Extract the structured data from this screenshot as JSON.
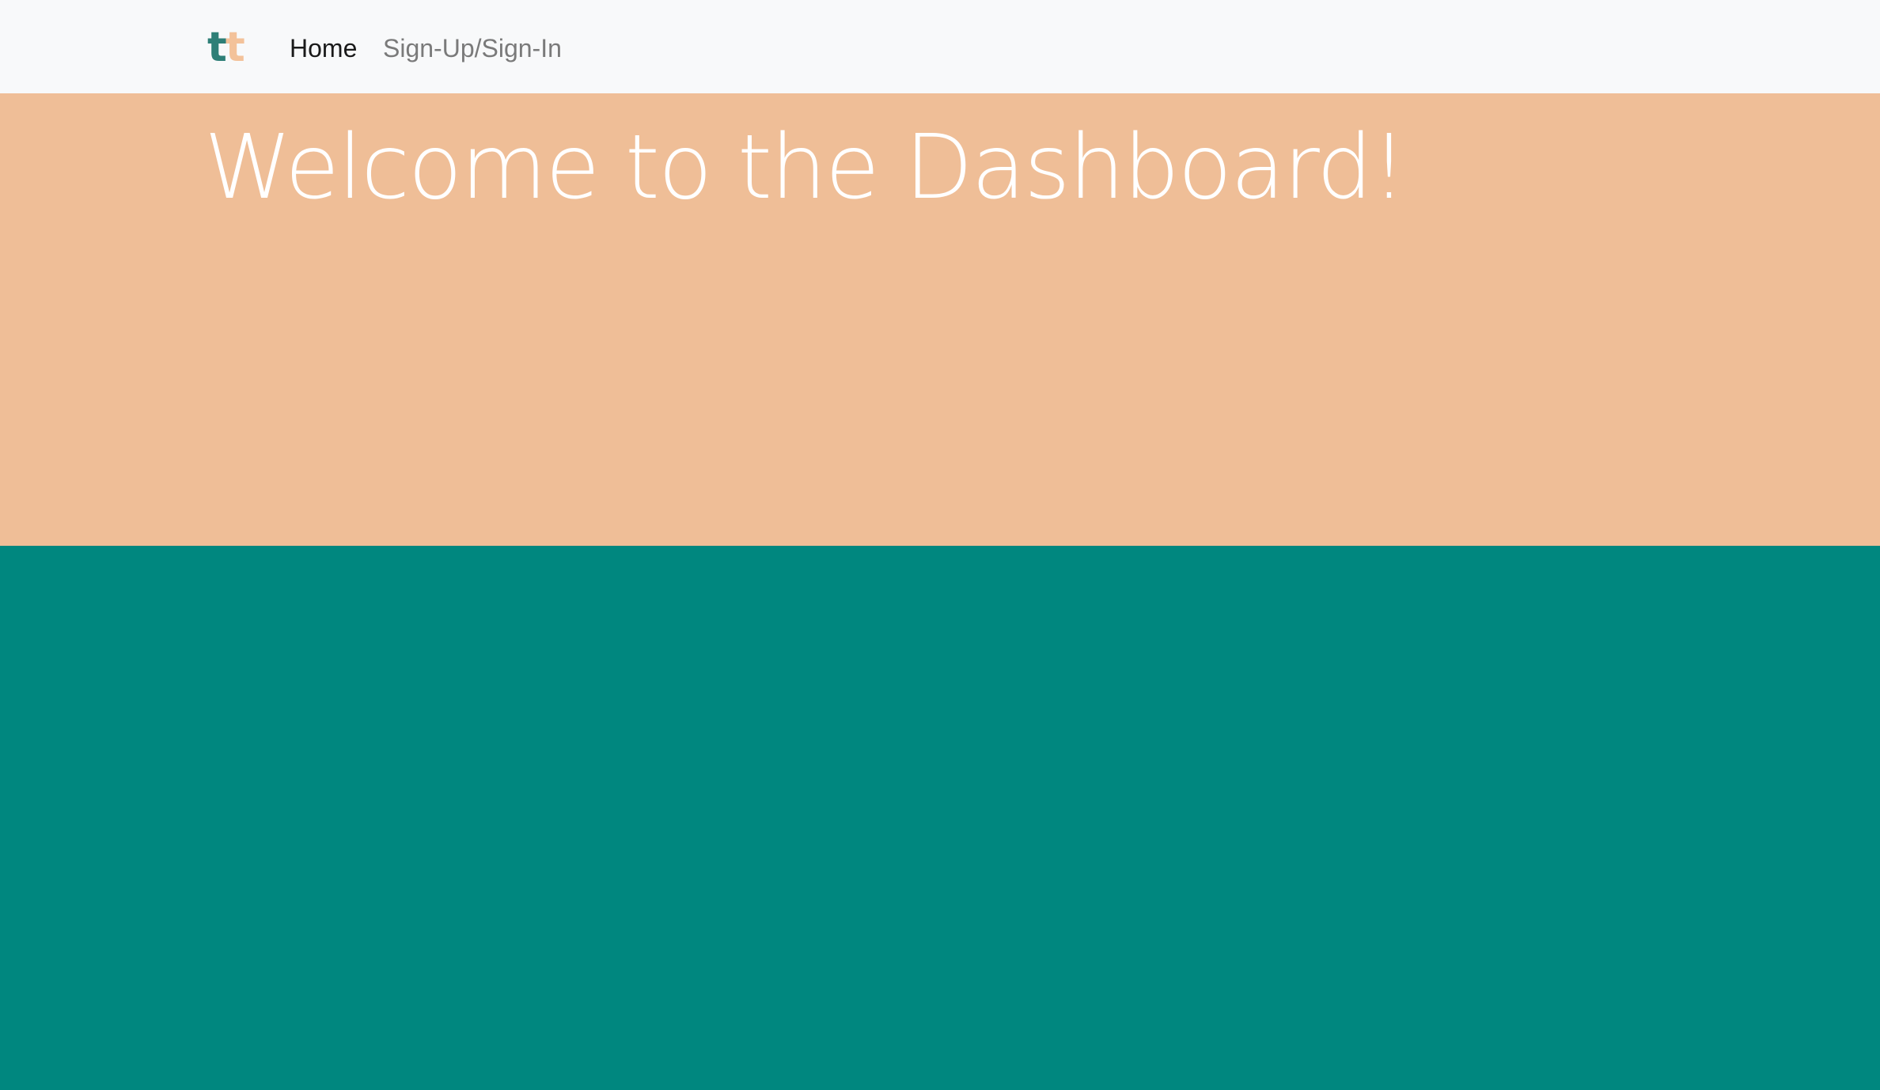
{
  "navbar": {
    "brand": {
      "letter1": "t",
      "letter2": "t"
    },
    "links": [
      {
        "label": "Home",
        "active": true
      },
      {
        "label": "Sign-Up/Sign-In",
        "active": false
      }
    ]
  },
  "hero": {
    "title": "Welcome to the Dashboard!"
  },
  "colors": {
    "navbar_bg": "#f8f9fa",
    "hero_bg": "#efbe97",
    "section_bg": "#00877f",
    "brand_primary": "#2e7f77",
    "brand_secondary": "#f3c29a",
    "hero_text": "#ffffff"
  }
}
